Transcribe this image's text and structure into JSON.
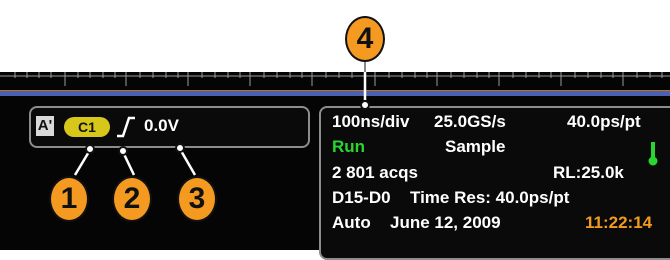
{
  "callouts": {
    "one": "1",
    "two": "2",
    "three": "3",
    "four": "4"
  },
  "trigger": {
    "source_mode": "A'",
    "channel": "C1",
    "slope_icon": "rising-edge-icon",
    "level": "0.0V"
  },
  "acquisition": {
    "horizontal_scale": "100ns/div",
    "sample_rate": "25.0GS/s",
    "resolution": "40.0ps/pt",
    "run_state": "Run",
    "mode": "Sample",
    "acqs": "2 801 acqs",
    "record_length": "RL:25.0k",
    "channels": "D15-D0",
    "time_res": "Time Res: 40.0ps/pt",
    "trigger_mode": "Auto",
    "date": "June 12, 2009",
    "time": "11:22:14"
  },
  "colors": {
    "accent": "#f59a21",
    "run": "#29d62e",
    "channel": "#d8c71b",
    "trace": "#4a62b4"
  }
}
